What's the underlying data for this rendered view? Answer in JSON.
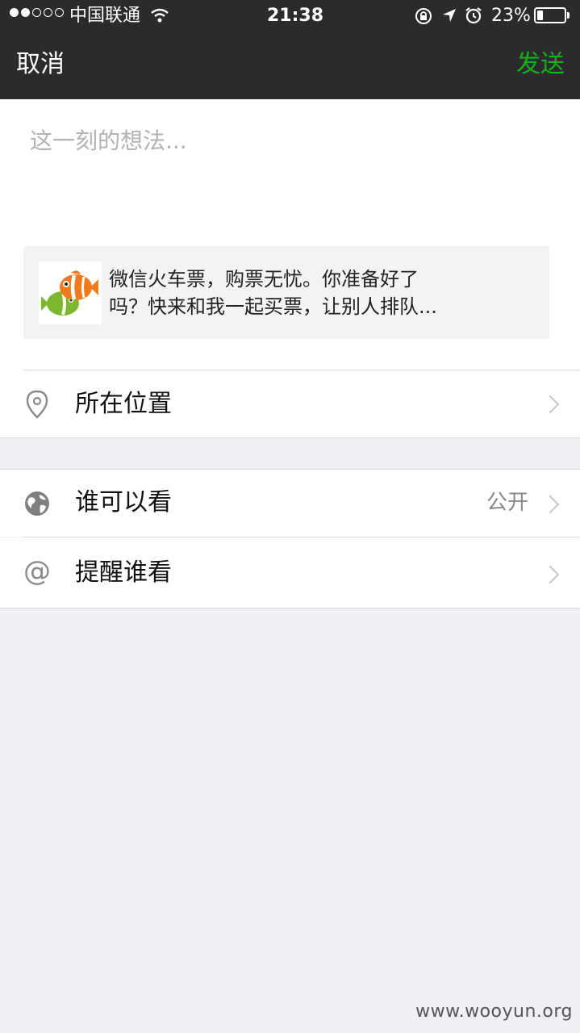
{
  "status_bar": {
    "carrier": "中国联通",
    "time": "21:38",
    "battery_percent_label": "23%",
    "battery_level": 0.23,
    "signal_bars_filled": 2,
    "signal_bars_total": 5
  },
  "nav": {
    "cancel_label": "取消",
    "send_label": "发送",
    "send_color": "#1aad19"
  },
  "compose": {
    "placeholder": "这一刻的想法..."
  },
  "share_card": {
    "thumbnail_icon": "clownfish-logo",
    "text_line1": "微信火车票，购票无忧。你准备好了",
    "text_line2": "吗？快来和我一起买票，让别人排队..."
  },
  "location_row": {
    "icon": "location-pin-icon",
    "label": "所在位置"
  },
  "visibility_row": {
    "icon": "globe-icon",
    "label": "谁可以看",
    "value": "公开"
  },
  "mention_row": {
    "icon": "at-icon",
    "label": "提醒谁看"
  },
  "watermark": "www.wooyun.org"
}
